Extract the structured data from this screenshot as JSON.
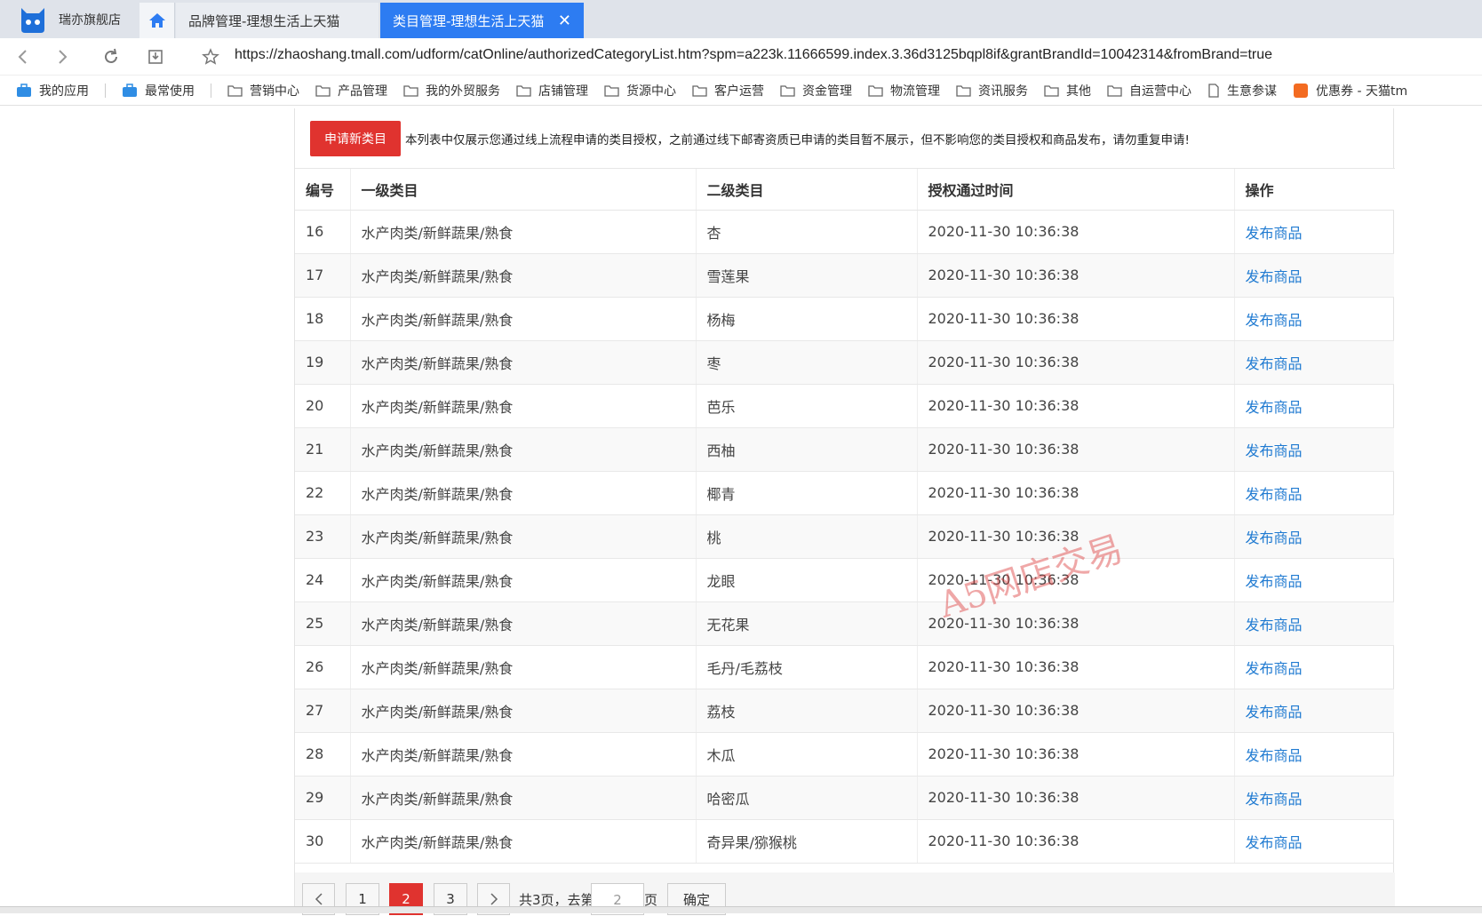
{
  "store": {
    "name": "瑞亦旗舰店"
  },
  "tabs": [
    {
      "label": "品牌管理-理想生活上天猫"
    },
    {
      "label": "类目管理-理想生活上天猫"
    }
  ],
  "address": {
    "url": "https://zhaoshang.tmall.com/udform/catOnline/authorizedCategoryList.htm?spm=a223k.11666599.index.3.36d3125bqpl8if&grantBrandId=10042314&fromBrand=true"
  },
  "bookmarks": [
    "我的应用",
    "最常使用",
    "营销中心",
    "产品管理",
    "我的外贸服务",
    "店铺管理",
    "货源中心",
    "客户运营",
    "资金管理",
    "物流管理",
    "资讯服务",
    "其他",
    "自运营中心",
    "生意参谋",
    "优惠券 - 天猫tm"
  ],
  "notice": {
    "apply_label": "申请新类目",
    "text": "本列表中仅展示您通过线上流程申请的类目授权，之前通过线下邮寄资质已申请的类目暂不展示，但不影响您的类目授权和商品发布，请勿重复申请!"
  },
  "table": {
    "headers": [
      "编号",
      "一级类目",
      "二级类目",
      "授权通过时间",
      "操作"
    ],
    "rows": [
      {
        "id": "16",
        "cat1": "水产肉类/新鲜蔬果/熟食",
        "cat2": "杏",
        "time": "2020-11-30 10:36:38",
        "action": "发布商品"
      },
      {
        "id": "17",
        "cat1": "水产肉类/新鲜蔬果/熟食",
        "cat2": "雪莲果",
        "time": "2020-11-30 10:36:38",
        "action": "发布商品"
      },
      {
        "id": "18",
        "cat1": "水产肉类/新鲜蔬果/熟食",
        "cat2": "杨梅",
        "time": "2020-11-30 10:36:38",
        "action": "发布商品"
      },
      {
        "id": "19",
        "cat1": "水产肉类/新鲜蔬果/熟食",
        "cat2": "枣",
        "time": "2020-11-30 10:36:38",
        "action": "发布商品"
      },
      {
        "id": "20",
        "cat1": "水产肉类/新鲜蔬果/熟食",
        "cat2": "芭乐",
        "time": "2020-11-30 10:36:38",
        "action": "发布商品"
      },
      {
        "id": "21",
        "cat1": "水产肉类/新鲜蔬果/熟食",
        "cat2": "西柚",
        "time": "2020-11-30 10:36:38",
        "action": "发布商品"
      },
      {
        "id": "22",
        "cat1": "水产肉类/新鲜蔬果/熟食",
        "cat2": "椰青",
        "time": "2020-11-30 10:36:38",
        "action": "发布商品"
      },
      {
        "id": "23",
        "cat1": "水产肉类/新鲜蔬果/熟食",
        "cat2": "桃",
        "time": "2020-11-30 10:36:38",
        "action": "发布商品"
      },
      {
        "id": "24",
        "cat1": "水产肉类/新鲜蔬果/熟食",
        "cat2": "龙眼",
        "time": "2020-11-30 10:36:38",
        "action": "发布商品"
      },
      {
        "id": "25",
        "cat1": "水产肉类/新鲜蔬果/熟食",
        "cat2": "无花果",
        "time": "2020-11-30 10:36:38",
        "action": "发布商品"
      },
      {
        "id": "26",
        "cat1": "水产肉类/新鲜蔬果/熟食",
        "cat2": "毛丹/毛荔枝",
        "time": "2020-11-30 10:36:38",
        "action": "发布商品"
      },
      {
        "id": "27",
        "cat1": "水产肉类/新鲜蔬果/熟食",
        "cat2": "荔枝",
        "time": "2020-11-30 10:36:38",
        "action": "发布商品"
      },
      {
        "id": "28",
        "cat1": "水产肉类/新鲜蔬果/熟食",
        "cat2": "木瓜",
        "time": "2020-11-30 10:36:38",
        "action": "发布商品"
      },
      {
        "id": "29",
        "cat1": "水产肉类/新鲜蔬果/熟食",
        "cat2": "哈密瓜",
        "time": "2020-11-30 10:36:38",
        "action": "发布商品"
      },
      {
        "id": "30",
        "cat1": "水产肉类/新鲜蔬果/熟食",
        "cat2": "奇异果/猕猴桃",
        "time": "2020-11-30 10:36:38",
        "action": "发布商品"
      }
    ]
  },
  "watermark": "A5网店交易",
  "pagination": {
    "pages": [
      "1",
      "2",
      "3"
    ],
    "current": "2",
    "total_text": "共3页，去第",
    "goto_value": "2",
    "page_suffix": "页",
    "confirm_label": "确定"
  },
  "colors": {
    "accent": "#2d7cf2",
    "primary_button": "#e0332f",
    "link": "#1f7ad1"
  }
}
